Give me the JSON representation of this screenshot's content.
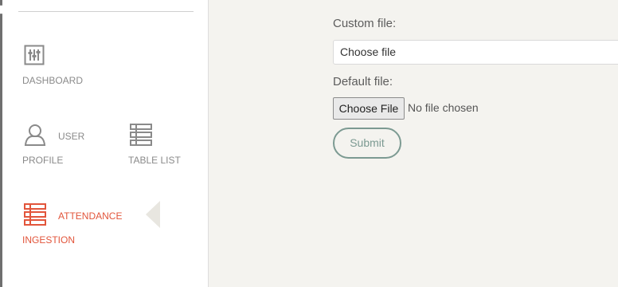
{
  "sidebar": {
    "items": [
      {
        "id": "dashboard",
        "label": "DASHBOARD",
        "icon": "sliders-icon",
        "active": false
      },
      {
        "id": "user-profile",
        "label_line1": "USER",
        "label_line2": "PROFILE",
        "icon": "user-icon",
        "active": false
      },
      {
        "id": "table-list",
        "label": "TABLE LIST",
        "icon": "list-icon",
        "active": false
      },
      {
        "id": "attendance-ingestion",
        "label_line1": "ATTENDANCE",
        "label_line2": "INGESTION",
        "icon": "list-icon",
        "active": true
      }
    ]
  },
  "form": {
    "custom_file_label": "Custom file:",
    "custom_file_placeholder": "Choose file",
    "default_file_label": "Default file:",
    "choose_file_button": "Choose File",
    "file_status": "No file chosen",
    "submit_label": "Submit"
  },
  "colors": {
    "accent": "#e2553b",
    "submit": "#7c9a92",
    "background": "#f4f3ef"
  }
}
